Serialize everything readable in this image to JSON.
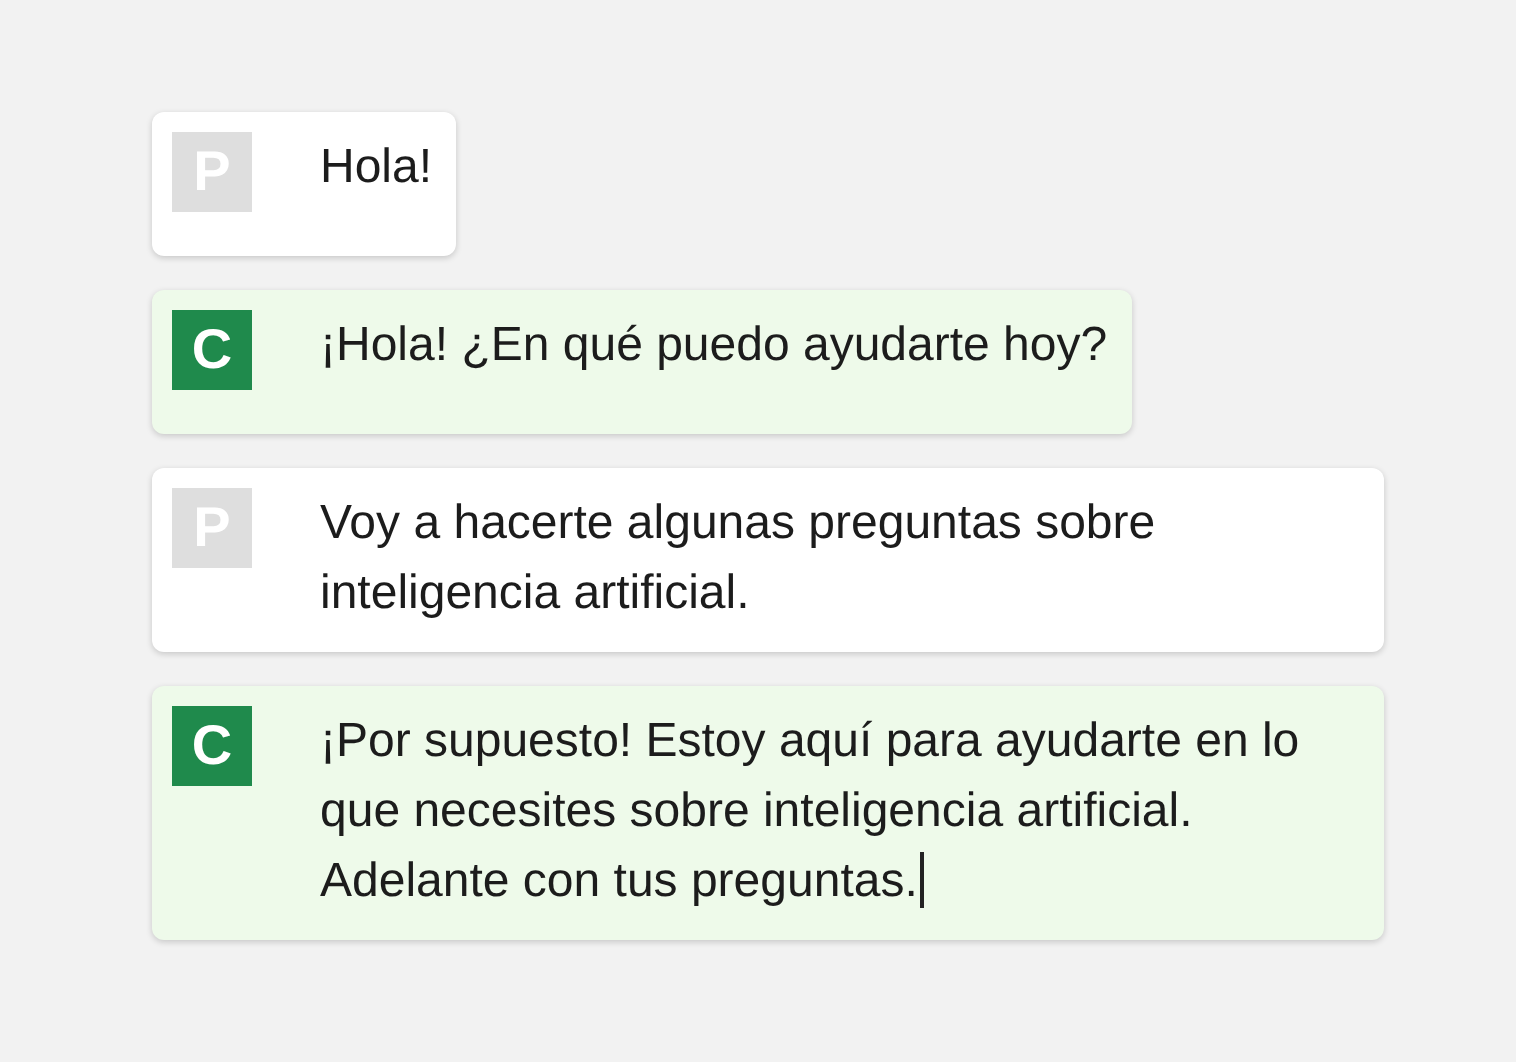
{
  "messages": [
    {
      "kind": "user",
      "avatar": "P",
      "text": "Hola!",
      "cursor": false
    },
    {
      "kind": "assistant",
      "avatar": "C",
      "text": "¡Hola! ¿En qué puedo ayudarte hoy?",
      "cursor": false
    },
    {
      "kind": "user",
      "avatar": "P",
      "text": "Voy a hacerte algunas preguntas sobre inteligencia artificial.",
      "cursor": false
    },
    {
      "kind": "assistant",
      "avatar": "C",
      "text": "¡Por supuesto! Estoy aquí para ayudarte en lo que necesites sobre inteligencia artificial. Adelante con tus preguntas.",
      "cursor": true
    }
  ]
}
